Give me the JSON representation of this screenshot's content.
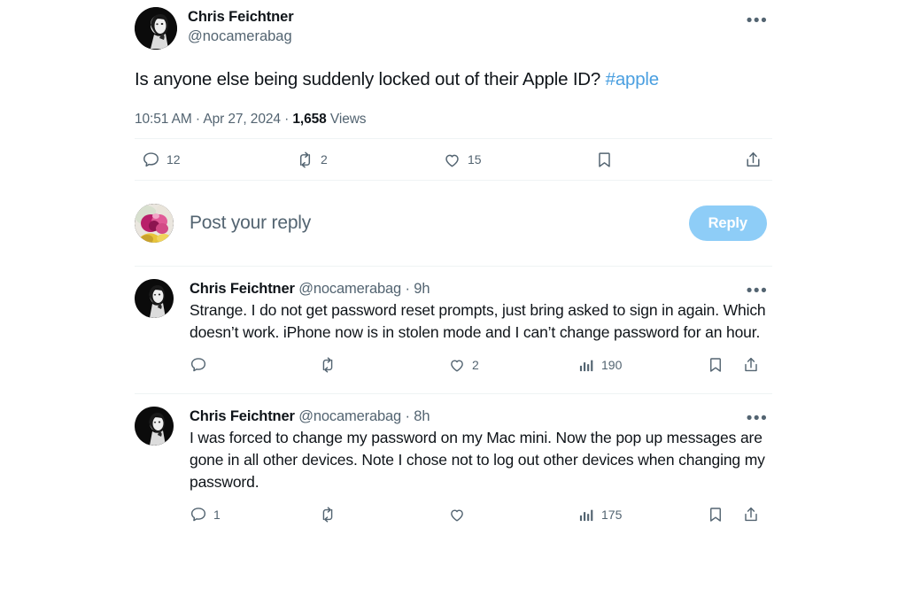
{
  "main_tweet": {
    "author_name": "Chris Feichtner",
    "author_handle": "@nocamerabag",
    "avatar_name": "portrait-photo-bw",
    "text_before_hashtag": "Is anyone else being suddenly locked out of their Apple ID? ",
    "hashtag": "#apple",
    "hashtag_color": "#4a9fe0",
    "time": "10:51 AM",
    "separator_1": " · ",
    "date": "Apr 27, 2024",
    "separator_2": " · ",
    "views_count": "1,658",
    "views_label": "Views",
    "more_glyph": "•••",
    "actions": {
      "reply": {
        "icon": "reply-icon",
        "count": "12"
      },
      "retweet": {
        "icon": "retweet-icon",
        "count": "2"
      },
      "like": {
        "icon": "heart-icon",
        "count": "15"
      },
      "bookmark": {
        "icon": "bookmark-icon",
        "count": ""
      },
      "share": {
        "icon": "share-icon",
        "count": ""
      }
    }
  },
  "composer": {
    "avatar_name": "floral-photo-avatar",
    "placeholder": "Post your reply",
    "reply_button_label": "Reply",
    "reply_button_color": "#8ecdf7"
  },
  "replies": [
    {
      "author_name": "Chris Feichtner",
      "author_handle": "@nocamerabag",
      "time_sep": " · ",
      "timestamp": "9h",
      "more_glyph": "•••",
      "text": "Strange. I do not get password reset prompts, just bring asked to sign in again. Which doesn’t work. iPhone now is in stolen mode and I can’t change password for an hour.",
      "actions": {
        "reply": {
          "icon": "reply-icon",
          "count": ""
        },
        "retweet": {
          "icon": "retweet-icon",
          "count": ""
        },
        "like": {
          "icon": "heart-icon",
          "count": "2"
        },
        "views": {
          "icon": "views-bar-chart-icon",
          "count": "190"
        },
        "bookmark": {
          "icon": "bookmark-icon",
          "count": ""
        },
        "share": {
          "icon": "share-icon",
          "count": ""
        }
      }
    },
    {
      "author_name": "Chris Feichtner",
      "author_handle": "@nocamerabag",
      "time_sep": " · ",
      "timestamp": "8h",
      "more_glyph": "•••",
      "text": "I was forced to change my password on my Mac mini. Now the pop up messages are gone in all other devices. Note I chose not to log out other devices when changing my password.",
      "actions": {
        "reply": {
          "icon": "reply-icon",
          "count": "1"
        },
        "retweet": {
          "icon": "retweet-icon",
          "count": ""
        },
        "like": {
          "icon": "heart-icon",
          "count": ""
        },
        "views": {
          "icon": "views-bar-chart-icon",
          "count": "175"
        },
        "bookmark": {
          "icon": "bookmark-icon",
          "count": ""
        },
        "share": {
          "icon": "share-icon",
          "count": ""
        }
      }
    }
  ],
  "theme": {
    "text_primary": "#0f1419",
    "text_secondary": "#536471",
    "divider": "#eff3f4",
    "background": "#ffffff"
  }
}
